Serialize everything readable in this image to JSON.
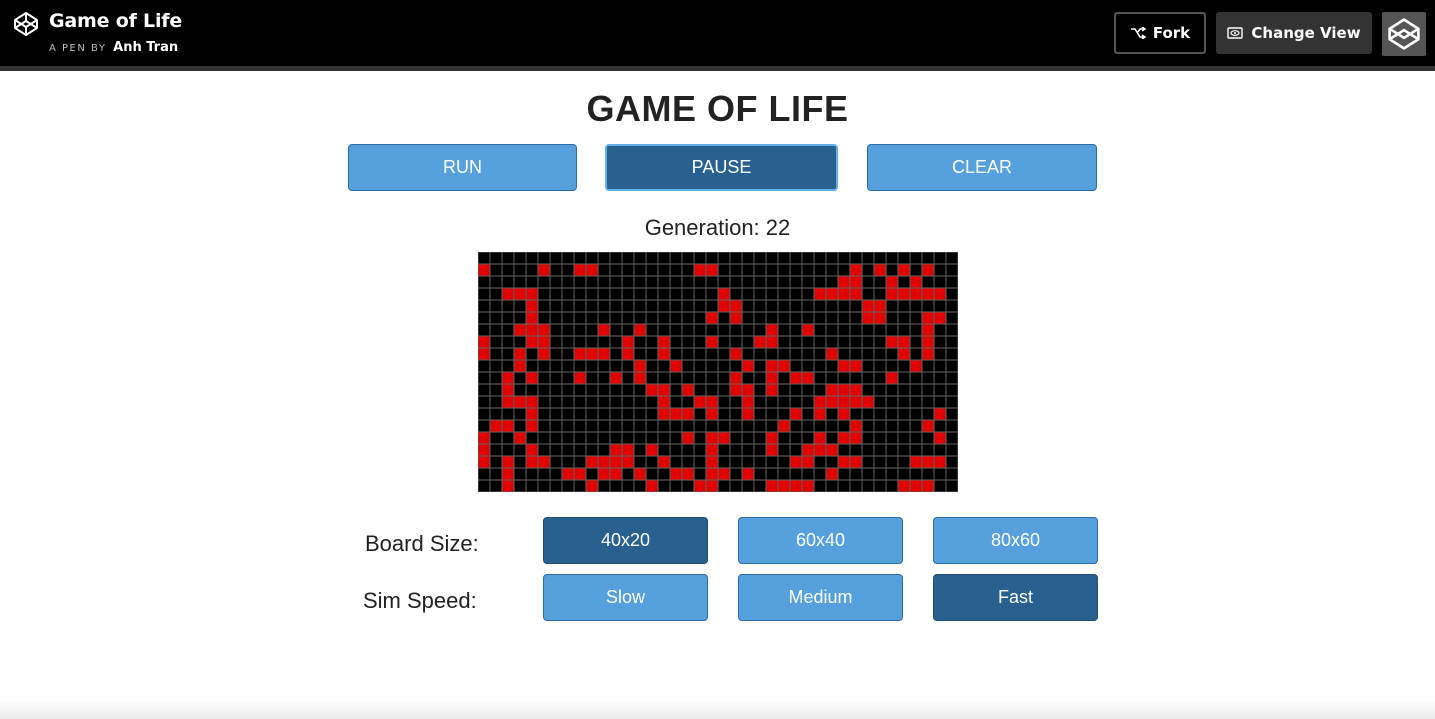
{
  "header": {
    "title": "Game of Life",
    "byline_prefix": "A PEN BY",
    "author": "Anh Tran",
    "fork_label": "Fork",
    "change_view_label": "Change View",
    "logo_icon": "codepen-logo-icon",
    "fork_icon": "fork-icon",
    "change_view_icon": "eye-icon"
  },
  "app": {
    "title": "GAME OF LIFE",
    "controls": {
      "run": "RUN",
      "pause": "PAUSE",
      "clear": "CLEAR",
      "active": "pause"
    },
    "generation_label": "Generation:",
    "generation": "22",
    "board": {
      "cols": 40,
      "rows": 20,
      "alive_color": "#e00000",
      "dead_color": "#000000",
      "grid_color": "#666666",
      "cells": [
        "..........................................",
        "x....x..xx........xx...........x.x.x.x..",
        "..............................xx..x.x...",
        "..xxx...............x.......xxxx..xxxxx.",
        "....x...............xx..........xx......",
        "....x..............x.x..........xx...xx.",
        "...xxx....x..x..........x..x.........x..",
        "x...xx......x..x...x...xx.........xx.x..",
        "x..x.x..xxx.x..x.....x.......x.....x.x..",
        "...x.........x..x.....x.xx....xx....x...",
        "..x.x...x..x.x.......x..x.xx......x.....",
        "..x...........xx.x...xx.x....xxx........",
        "..xxx..........x..xx..x.....xxxxx.......",
        "....x..........xxx.x..x...x.x.x.......x.",
        ".xx.x....................x.....x.....x..",
        "x..x.............x.xx...x...x.xx......x.",
        "x...x......xx.x....x....x..xxx.........",
        "x.x.xx...xxxx..x...x......xx..xx....xxx.",
        "..x....xx.xx.x..xx.xx.x......x..........",
        "..x......x....x...xx....xxxx.......xxx.."
      ]
    },
    "board_size_label": "Board Size:",
    "board_sizes": [
      "40x20",
      "60x40",
      "80x60"
    ],
    "active_board_size": "40x20",
    "sim_speed_label": "Sim Speed:",
    "sim_speeds": [
      "Slow",
      "Medium",
      "Fast"
    ],
    "active_sim_speed": "Fast"
  }
}
